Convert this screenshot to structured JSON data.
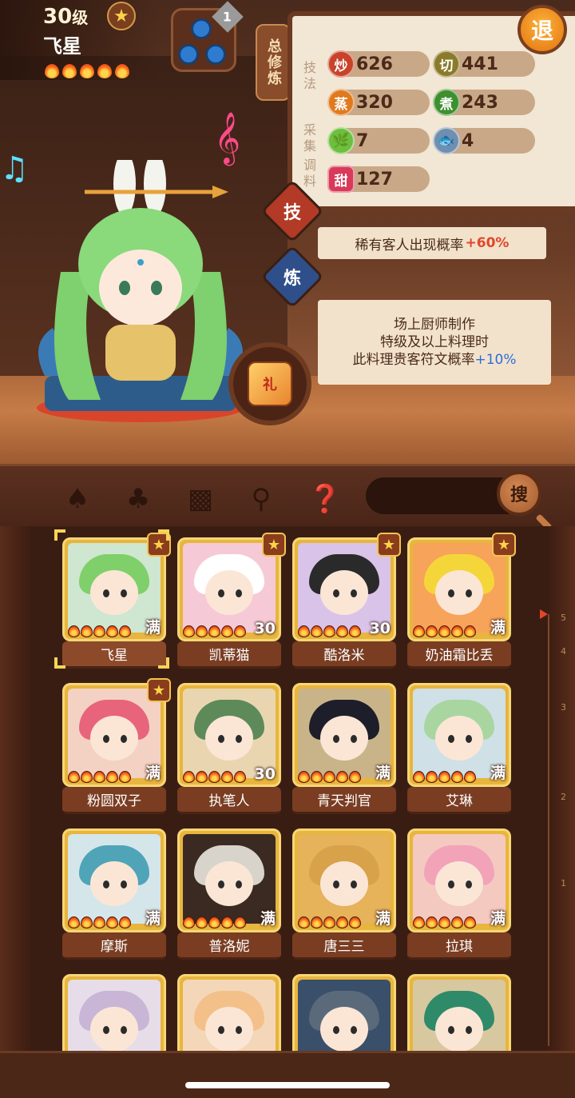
{
  "header": {
    "level": "30",
    "level_unit": "级",
    "chef_name": "飞星",
    "star_count": 5,
    "gear_badge": "1"
  },
  "tabs": {
    "total_training": "总修炼"
  },
  "panel": {
    "group_skill": "技法",
    "group_collect": "采集",
    "group_season": "调料",
    "stats": [
      {
        "icon": "炒",
        "value": "626",
        "color": "#c8432a"
      },
      {
        "icon": "切",
        "value": "441",
        "color": "#8a7a2a"
      },
      {
        "icon": "蒸",
        "value": "320",
        "color": "#e07a1f"
      },
      {
        "icon": "煮",
        "value": "243",
        "color": "#3f8f2f"
      },
      {
        "icon": "vegetable-icon",
        "value": "7",
        "color": "#6cbf3f"
      },
      {
        "icon": "fish-icon",
        "value": "4",
        "color": "#6f8fb0"
      },
      {
        "icon": "甜",
        "value": "127",
        "color": "#d83a5a"
      }
    ]
  },
  "buttons": {
    "exit": "退",
    "skill": "技",
    "train": "炼",
    "search": "搜"
  },
  "effects": {
    "rare_guest_text": "稀有客人出现概率",
    "rare_guest_value": "+60%",
    "note_line1": "场上厨师制作",
    "note_line2": "特级及以上料理时",
    "note_line3": "此料理贵客符文概率",
    "note_value": "+10%"
  },
  "dish_label": "礼",
  "filters": [
    "shovel-icon",
    "spatula-icon",
    "jar-icon",
    "location-icon",
    "map-question-icon"
  ],
  "ruler_ticks": [
    "5",
    "4",
    "3",
    "2",
    "1"
  ],
  "chefs": [
    {
      "name": "飞星",
      "badge": "满",
      "star": true,
      "hair": "#7fcf6a",
      "bg": "#cfe6d0",
      "selected": true
    },
    {
      "name": "凯蒂猫",
      "badge": "30",
      "star": true,
      "hair": "#ffffff",
      "bg": "#f6c9d6"
    },
    {
      "name": "酷洛米",
      "badge": "30",
      "star": true,
      "hair": "#2a2a2a",
      "bg": "#d9c3e8"
    },
    {
      "name": "奶油霜比丢",
      "badge": "满",
      "star": true,
      "hair": "#f4d63a",
      "bg": "#f7a35a"
    },
    {
      "name": "粉圆双子",
      "badge": "满",
      "star": true,
      "hair": "#e8647a",
      "bg": "#f3d2c4"
    },
    {
      "name": "执笔人",
      "badge": "30",
      "star": false,
      "hair": "#5e8a5a",
      "bg": "#e9d6b0"
    },
    {
      "name": "青天判官",
      "badge": "满",
      "star": false,
      "hair": "#1e1e2a",
      "bg": "#c9b48a"
    },
    {
      "name": "艾琳",
      "badge": "满",
      "star": false,
      "hair": "#a9d6a0",
      "bg": "#cfe0e6"
    },
    {
      "name": "摩斯",
      "badge": "满",
      "star": false,
      "hair": "#4fa4b8",
      "bg": "#d4e6ea"
    },
    {
      "name": "普洛妮",
      "badge": "满",
      "star": false,
      "hair": "#d8d4cc",
      "bg": "#3a2a22"
    },
    {
      "name": "唐三三",
      "badge": "满",
      "star": false,
      "hair": "#d8a24a",
      "bg": "#e6b25a"
    },
    {
      "name": "拉琪",
      "badge": "满",
      "star": false,
      "hair": "#f2a3b8",
      "bg": "#f4c9c0"
    },
    {
      "name": "",
      "badge": "",
      "star": false,
      "hair": "#c9b6d6",
      "bg": "#e6dde8"
    },
    {
      "name": "",
      "badge": "",
      "star": false,
      "hair": "#f4c08a",
      "bg": "#f3d7b8"
    },
    {
      "name": "",
      "badge": "",
      "star": false,
      "hair": "#5a6a7a",
      "bg": "#3a4f6a"
    },
    {
      "name": "",
      "badge": "",
      "star": false,
      "hair": "#2f8a6a",
      "bg": "#d8c8a0"
    }
  ]
}
